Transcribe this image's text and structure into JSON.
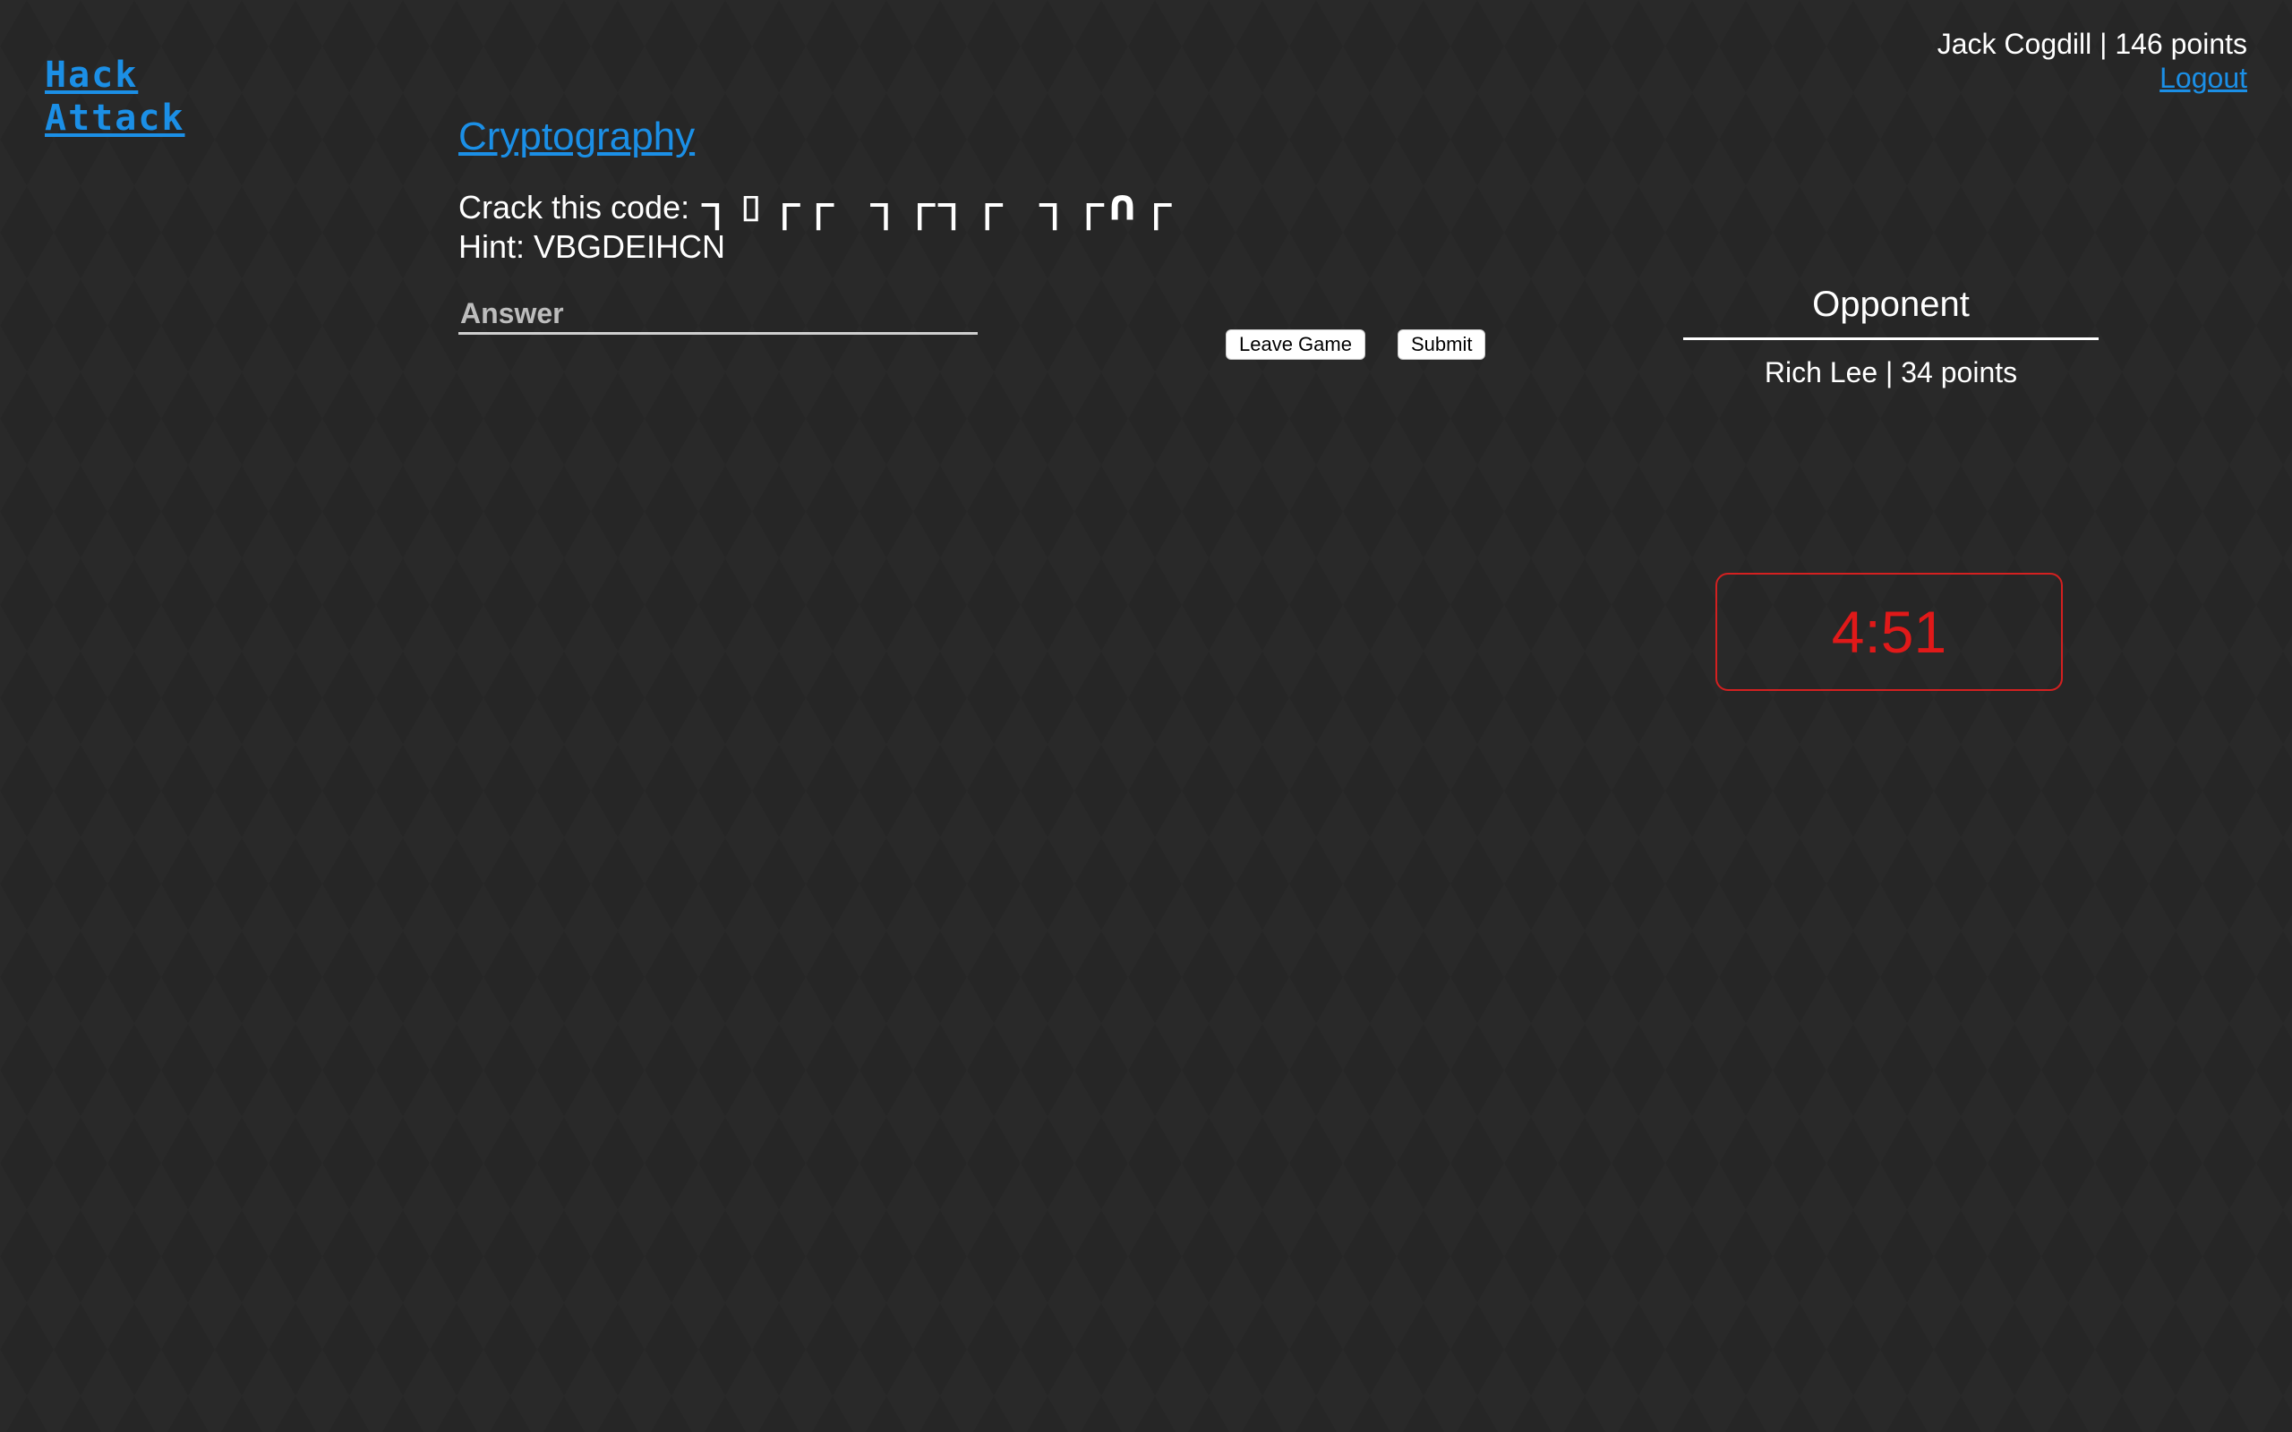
{
  "logo": {
    "line1": "Hack",
    "line2": "Attack"
  },
  "user": {
    "info": "Jack Cogdill | 146 points",
    "logout_label": "Logout"
  },
  "category": "Cryptography",
  "challenge": {
    "prompt": "Crack this code:",
    "code": "┐▯┌┌ ┐┌┐┌ ┐┌∩┌",
    "hint": "Hint: VBGDEIHCN"
  },
  "answer": {
    "placeholder": "Answer",
    "value": ""
  },
  "buttons": {
    "leave_label": "Leave Game",
    "submit_label": "Submit"
  },
  "opponent": {
    "heading": "Opponent",
    "info": "Rich Lee | 34 points"
  },
  "timer": {
    "value": "4:51"
  },
  "colors": {
    "accent": "#1b8fe6",
    "timer": "#e01919",
    "background": "#262626"
  }
}
